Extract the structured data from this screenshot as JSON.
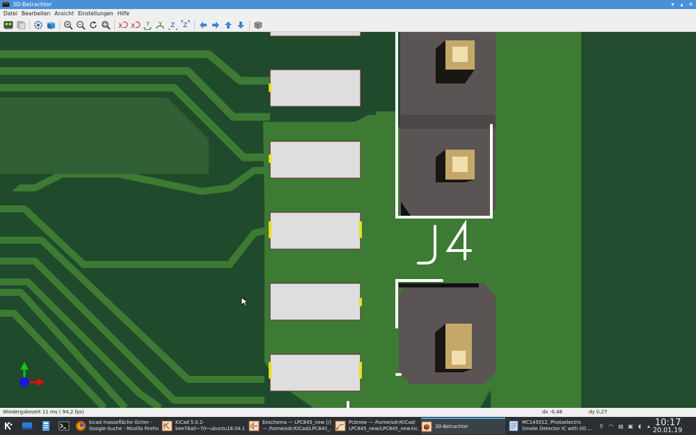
{
  "window": {
    "title": "3D-Betrachter"
  },
  "menu": [
    "Datei",
    "Bearbeiten",
    "Ansicht",
    "Einstellungen",
    "Hilfe"
  ],
  "toolbar": {
    "buttons": [
      "render-view-icon",
      "copy-icon",
      "settings-icon",
      "3d-box-icon",
      "zoom-in-icon",
      "zoom-out-icon",
      "redraw-icon",
      "zoom-fit-icon",
      "rotate-x-cw-icon",
      "rotate-x-ccw-icon",
      "rotate-y-cw-icon",
      "rotate-y-ccw-icon",
      "rotate-z-cw-icon",
      "rotate-z-ccw-icon",
      "arrow-left-icon",
      "arrow-right-icon",
      "arrow-up-icon",
      "arrow-down-icon",
      "orthographic-icon"
    ]
  },
  "board": {
    "silkscreen_label": "J4",
    "colors": {
      "board": "#1f4a2b",
      "copper": "#3d7a33",
      "pad": "#dedede",
      "pad_gold": "#e8e020",
      "connector": "#5b5454",
      "pin": "#c4a86a",
      "silk": "#ffffff"
    }
  },
  "status": {
    "render_time": "Wiedergabezeit 11 ms ( 94,2 fps)",
    "dx": "dx -0,48",
    "dy": "dy 0,27"
  },
  "taskbar": {
    "tasks": [
      {
        "line1": "kicad massefläche löcher -",
        "line2": "Google-Suche - Mozilla Firefox"
      },
      {
        "line1": "KiCad 5.0.2-",
        "line2": "bee76a0~70~ubuntu18.04.1 ..."
      },
      {
        "line1": "Eeschema — LPC845_new [/]",
        "line2": "— /home/sdr/KiCad/LPC845_..."
      },
      {
        "line1": "Pcbnew — /home/sdr/KiCad/",
        "line2": "LPC845_new/LPC845_new.kic..."
      },
      {
        "line1": "3D-Betrachter",
        "line2": ""
      },
      {
        "line1": "MC145012, Photoelectric",
        "line2": "Smoke Detector IC with I/O ..."
      }
    ],
    "clock": {
      "time": "10:17",
      "date": "20.01.19"
    }
  }
}
